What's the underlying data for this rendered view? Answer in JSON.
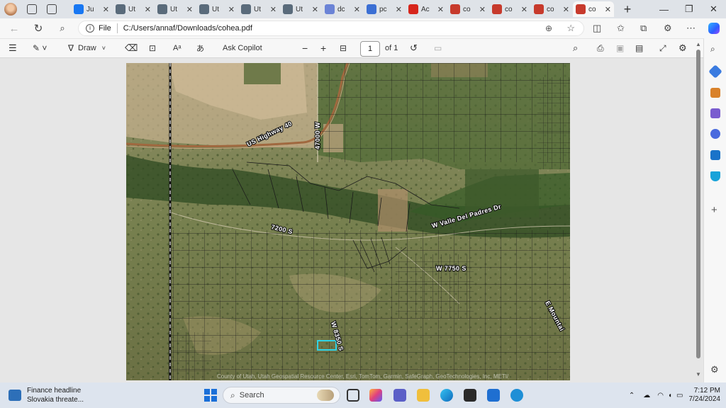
{
  "tabs": [
    {
      "title": "Ju",
      "icon": "facebook-icon",
      "color": "#1877f2"
    },
    {
      "title": "Ut",
      "icon": "home-icon",
      "color": "#5a6b7b"
    },
    {
      "title": "Ut",
      "icon": "home-icon",
      "color": "#5a6b7b"
    },
    {
      "title": "Ut",
      "icon": "home-icon",
      "color": "#5a6b7b"
    },
    {
      "title": "Ut",
      "icon": "home-icon",
      "color": "#5a6b7b"
    },
    {
      "title": "Ut",
      "icon": "home-icon",
      "color": "#5a6b7b"
    },
    {
      "title": "dc",
      "icon": "copilot-icon",
      "color": "#6b83d6"
    },
    {
      "title": "pc",
      "icon": "search-icon",
      "color": "#3b6fd4"
    },
    {
      "title": "Ac",
      "icon": "adobe-icon",
      "color": "#d7261c"
    },
    {
      "title": "co",
      "icon": "pdf-icon",
      "color": "#c73a2c"
    },
    {
      "title": "co",
      "icon": "pdf-icon",
      "color": "#c73a2c"
    },
    {
      "title": "co",
      "icon": "pdf-icon",
      "color": "#c73a2c"
    },
    {
      "title": "co",
      "icon": "pdf-icon",
      "color": "#c73a2c"
    }
  ],
  "address": {
    "scheme_label": "File",
    "url": "C:/Users/annaf/Downloads/cohea.pdf"
  },
  "pdf_toolbar": {
    "draw_label": "Draw",
    "copilot_label": "Ask Copilot",
    "page_current": "1",
    "page_total": "of 1"
  },
  "map": {
    "labels": {
      "highway": "US Highway 40",
      "w47000": "47000 W",
      "s7200": "7200 S",
      "valle": "W Valle Del Padres Dr",
      "w7750": "W 7750 S",
      "emount": "E Mountai",
      "s8350": "W 8350 S"
    },
    "attribution": "County of Utah, Utah Geospatial Resource Center, Esri, TomTom, Garmin, SafeGraph, GeoTechnologies, Inc, METI/"
  },
  "taskbar": {
    "news_title": "Finance headline",
    "news_sub": "Slovakia threate...",
    "search_placeholder": "Search",
    "time": "7:12 PM",
    "date": "7/24/2024"
  },
  "colors": {
    "accent": "#0f6cbd",
    "parcel_highlight": "#2fd3e6"
  }
}
